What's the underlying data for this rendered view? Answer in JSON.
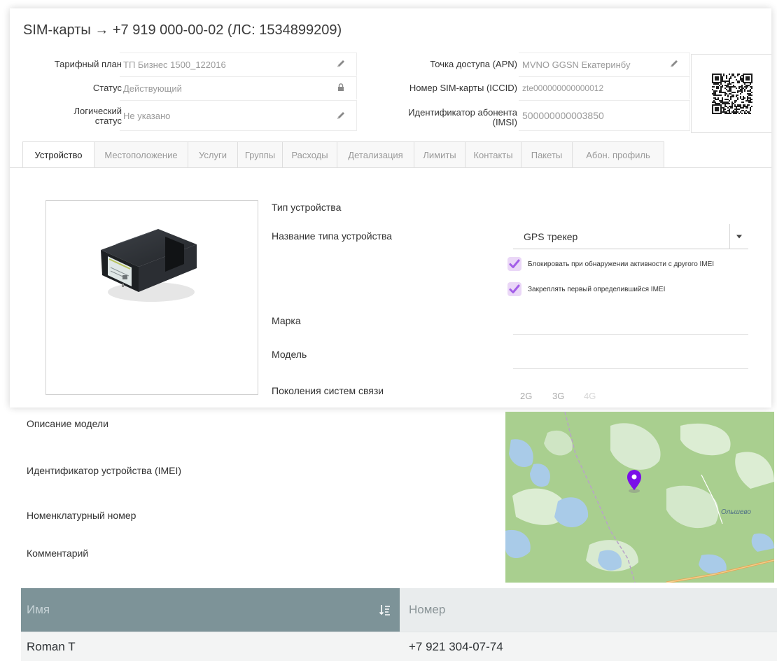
{
  "header": {
    "breadcrumb_root": "SIM-карты",
    "breadcrumb_arrow": "→",
    "title": "+7 919 000-00-02 (ЛС: 1534899209)"
  },
  "info": {
    "tariff_label": "Тарифный план",
    "tariff_value": "ТП Бизнес 1500_122016",
    "status_label": "Статус",
    "status_value": "Действующий",
    "logical_status_label_1": "Логический",
    "logical_status_label_2": "статус",
    "logical_status_value": "Не указано",
    "apn_label": "Точка доступа (APN)",
    "apn_value": "MVNO GGSN Екатеринбу",
    "iccid_label": "Номер SIM-карты (ICCID)",
    "iccid_value": "zte000000000000012",
    "imsi_label_1": "Идентификатор абонента",
    "imsi_label_2": "(IMSI)",
    "imsi_value": "500000000003850"
  },
  "tabs": [
    {
      "label": "Устройство",
      "active": true
    },
    {
      "label": "Местоположение"
    },
    {
      "label": "Услуги"
    },
    {
      "label": "Группы"
    },
    {
      "label": "Расходы"
    },
    {
      "label": "Детализация"
    },
    {
      "label": "Лимиты"
    },
    {
      "label": "Контакты"
    },
    {
      "label": "Пакеты"
    },
    {
      "label": "Абон. профиль"
    }
  ],
  "device": {
    "type_heading": "Тип устройства",
    "type_name_label": "Название типа устройства",
    "type_name_value": "GPS трекер",
    "block_imei_label": "Блокировать при обнаружении активности с другого IMEI",
    "block_imei_checked": true,
    "bind_imei_label": "Закреплять первый определившийся IMEI",
    "bind_imei_checked": true,
    "brand_label": "Марка",
    "model_label": "Модель",
    "generations_label": "Поколения систем связи",
    "generations": [
      "2G",
      "3G",
      "4G"
    ],
    "model_description_label": "Описание модели",
    "imei_label": "Идентификатор устройства (IMEI)",
    "nomenclature_label": "Номенклатурный номер",
    "comment_label": "Комментарий"
  },
  "map": {
    "place_label": "Ольшево",
    "marker_color": "#7a10e8"
  },
  "contacts_table": {
    "headers": [
      "Имя",
      "Номер"
    ],
    "rows": [
      {
        "name": "Roman T",
        "number": "+7 921 304-07-74"
      }
    ]
  },
  "colors": {
    "accent": "#a35ee8",
    "table_header": "#7d9398"
  }
}
